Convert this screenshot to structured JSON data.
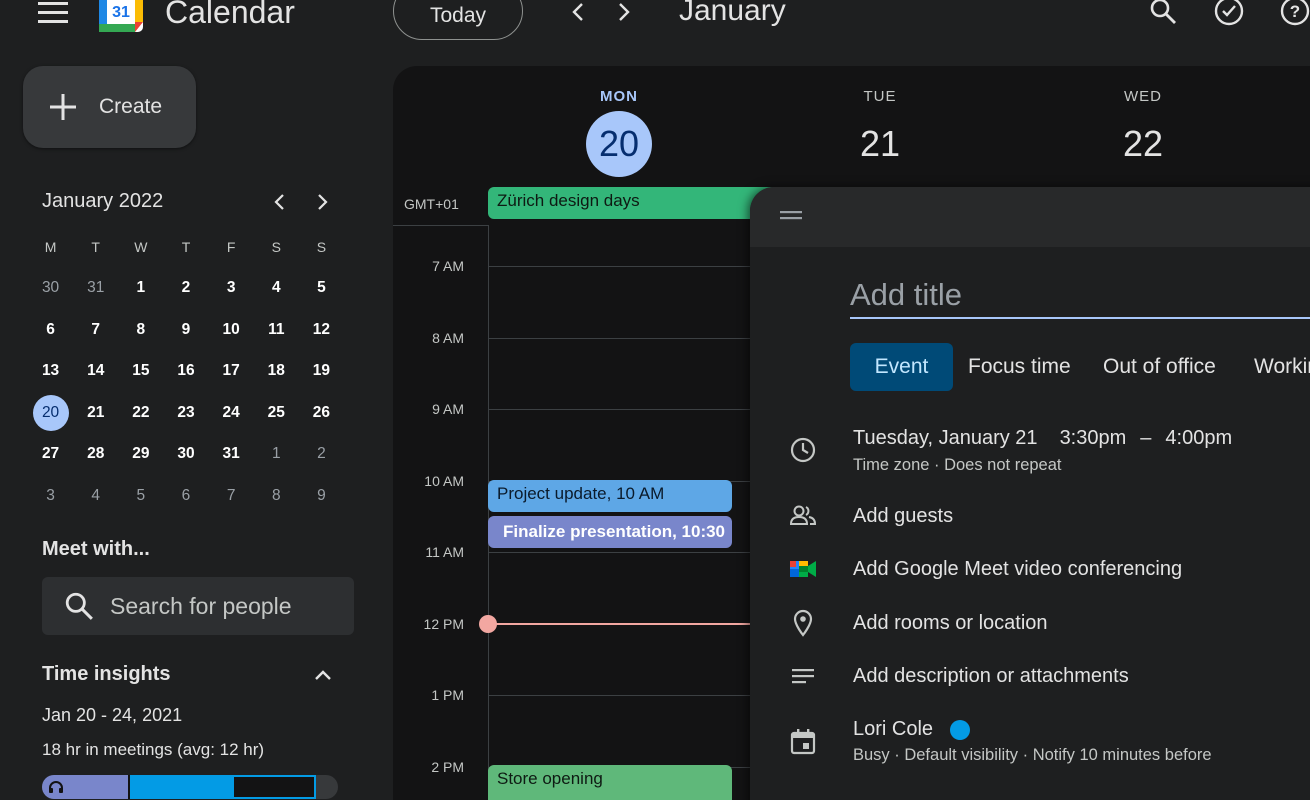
{
  "header": {
    "app_title": "Calendar",
    "logo_day": "31",
    "today_label": "Today",
    "month_title": "January"
  },
  "sidebar": {
    "create_label": "Create",
    "mini_calendar": {
      "month_label": "January 2022",
      "weekdays": [
        "M",
        "T",
        "W",
        "T",
        "F",
        "S",
        "S"
      ],
      "weeks": [
        [
          "30",
          "31",
          "1",
          "2",
          "3",
          "4",
          "5"
        ],
        [
          "6",
          "7",
          "8",
          "9",
          "10",
          "11",
          "12"
        ],
        [
          "13",
          "14",
          "15",
          "16",
          "17",
          "18",
          "19"
        ],
        [
          "20",
          "21",
          "22",
          "23",
          "24",
          "25",
          "26"
        ],
        [
          "27",
          "28",
          "29",
          "30",
          "31",
          "1",
          "2"
        ],
        [
          "3",
          "4",
          "5",
          "6",
          "7",
          "8",
          "9"
        ]
      ],
      "today": "20"
    },
    "meet_title": "Meet with...",
    "search_placeholder": "Search for people",
    "insights": {
      "title": "Time insights",
      "range": "Jan 20 - 24, 2021",
      "meetings": "18 hr in meetings (avg: 12 hr)"
    }
  },
  "calendar": {
    "timezone": "GMT+01",
    "days": [
      {
        "dow": "MON",
        "dom": "20",
        "today": true
      },
      {
        "dow": "TUE",
        "dom": "21",
        "today": false
      },
      {
        "dow": "WED",
        "dom": "22",
        "today": false
      }
    ],
    "hours": [
      "7 AM",
      "8 AM",
      "9 AM",
      "10 AM",
      "11 AM",
      "12 PM",
      "1 PM",
      "2 PM"
    ],
    "events": {
      "zurich": "Zürich design days",
      "project": "Project update, 10 AM",
      "finalize": "Finalize presentation, 10:30",
      "store": "Store opening"
    }
  },
  "dialog": {
    "title_placeholder": "Add title",
    "tabs": {
      "event": "Event",
      "focus": "Focus time",
      "ooo": "Out of office",
      "working": "Working location"
    },
    "datetime": {
      "date": "Tuesday, January 21",
      "start": "3:30pm",
      "dash": "–",
      "end": "4:00pm",
      "sub": "Time zone · Does not repeat"
    },
    "add_guests": "Add guests",
    "add_meet": "Add Google Meet video conferencing",
    "add_location": "Add rooms or location",
    "add_description": "Add description or attachments",
    "owner": "Lori Cole",
    "owner_sub": "Busy · Default visibility · Notify 10 minutes before"
  },
  "colors": {
    "today_blue": "#a8c7fa",
    "event_green": "#33b679",
    "event_blue": "#5ea7e6",
    "event_purple": "#7986cb",
    "now_line": "#f2a7a1",
    "calendar_dot": "#039be5"
  }
}
